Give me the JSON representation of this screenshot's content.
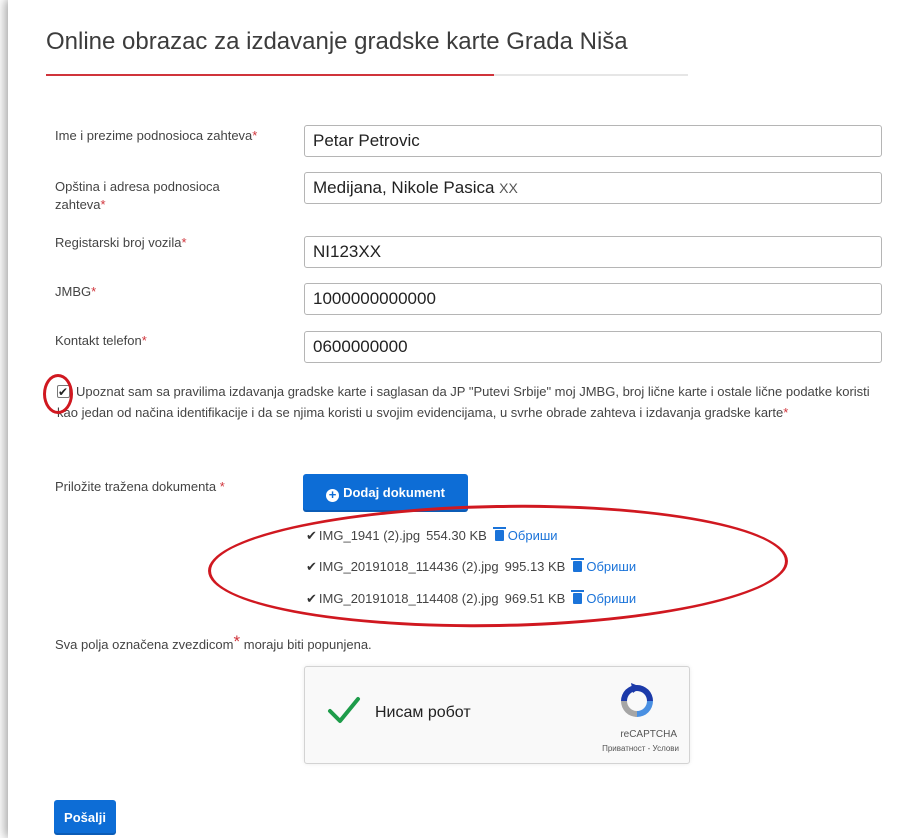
{
  "form": {
    "title": "Online obrazac za izdavanje gradske karte Grada Niša",
    "required_mark": "*",
    "fields": [
      {
        "label": "Ime i prezime podnosioca zahteva",
        "value": "Petar Petrovic"
      },
      {
        "label_line1": "Opština i adresa podnosioca",
        "label_line2": "zahteva",
        "value_main": "Medijana, Nikole Pasica ",
        "value_small": "XX"
      },
      {
        "label": "Registarski broj vozila",
        "value": "NI123XX"
      },
      {
        "label": "JMBG",
        "value": "1000000000000"
      },
      {
        "label": "Kontakt telefon",
        "value": "0600000000"
      }
    ],
    "consent": {
      "checked": true,
      "text": "Upoznat sam sa pravilima izdavanja gradske karte i saglasan da JP \"Putevi Srbije\" moj JMBG, broj lične karte i ostale lične podatke koristi kao jedan od načina identifikacije i da se njima koristi u svojim evidencijama, u svrhe obrade zahteva i izdavanja gradske karte"
    },
    "attachments": {
      "label": "Priložite tražena dokumenta ",
      "add_button": "Dodaj dokument",
      "delete_label": "Обриши",
      "files": [
        {
          "name": "IMG_1941 (2).jpg",
          "size": "554.30 KB"
        },
        {
          "name": "IMG_20191018_114436 (2).jpg",
          "size": "995.13 KB"
        },
        {
          "name": "IMG_20191018_114408 (2).jpg",
          "size": "969.51 KB"
        }
      ]
    },
    "note_before": "Sva polja označena zvezdicom",
    "note_after": " moraju biti popunjena.",
    "captcha": {
      "label": "Нисам робот",
      "brand": "reCAPTCHA",
      "privacy": "Приватност",
      "separator": " - ",
      "terms": "Услови"
    },
    "submit": "Pošalji"
  },
  "colors": {
    "accent_red": "#d0343b",
    "primary_blue": "#0d6dd6",
    "link_blue": "#1a73d9",
    "annotation_red": "#d01820"
  }
}
